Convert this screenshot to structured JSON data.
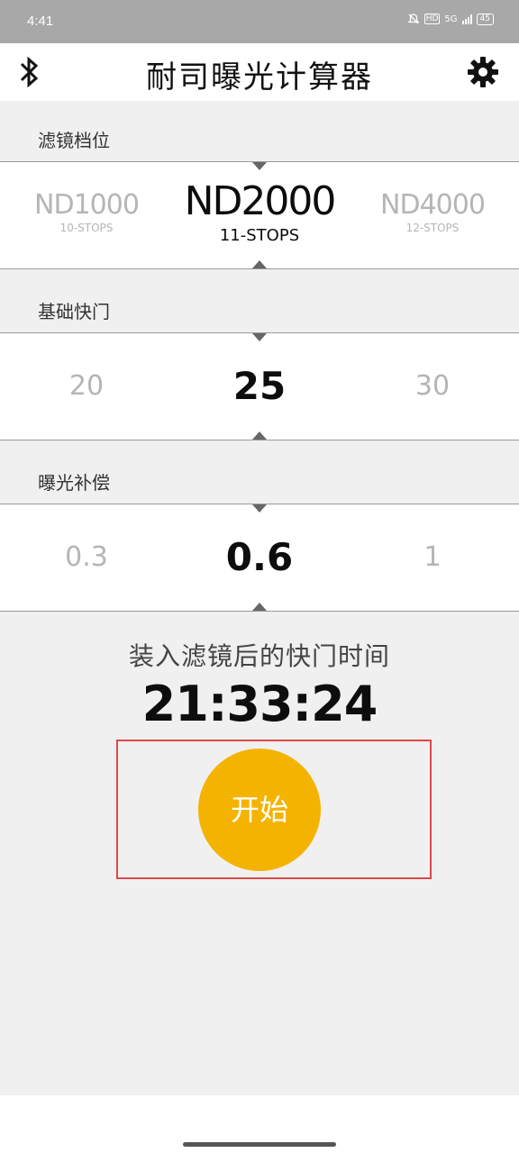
{
  "status_bar": {
    "time": "4:41",
    "network": "5G",
    "hd": "HD",
    "battery": "45"
  },
  "app": {
    "title": "耐司曝光计算器"
  },
  "nd_picker": {
    "label": "滤镜档位",
    "options": [
      {
        "name": "ND1000",
        "stops": "10-STOPS"
      },
      {
        "name": "ND2000",
        "stops": "11-STOPS"
      },
      {
        "name": "ND4000",
        "stops": "12-STOPS"
      }
    ]
  },
  "shutter_picker": {
    "label": "基础快门",
    "options": [
      "20",
      "25",
      "30"
    ]
  },
  "compensation_picker": {
    "label": "曝光补偿",
    "options": [
      "0.3",
      "0.6",
      "1"
    ]
  },
  "result": {
    "caption": "装入滤镜后的快门时间",
    "time": "21:33:24"
  },
  "start_button": {
    "label": "开始"
  },
  "colors": {
    "accent": "#f5b301",
    "highlight_frame": "#e04848",
    "background": "#f0f0f0"
  },
  "icons": {
    "left": "bluetooth-icon",
    "right": "gear-icon"
  }
}
